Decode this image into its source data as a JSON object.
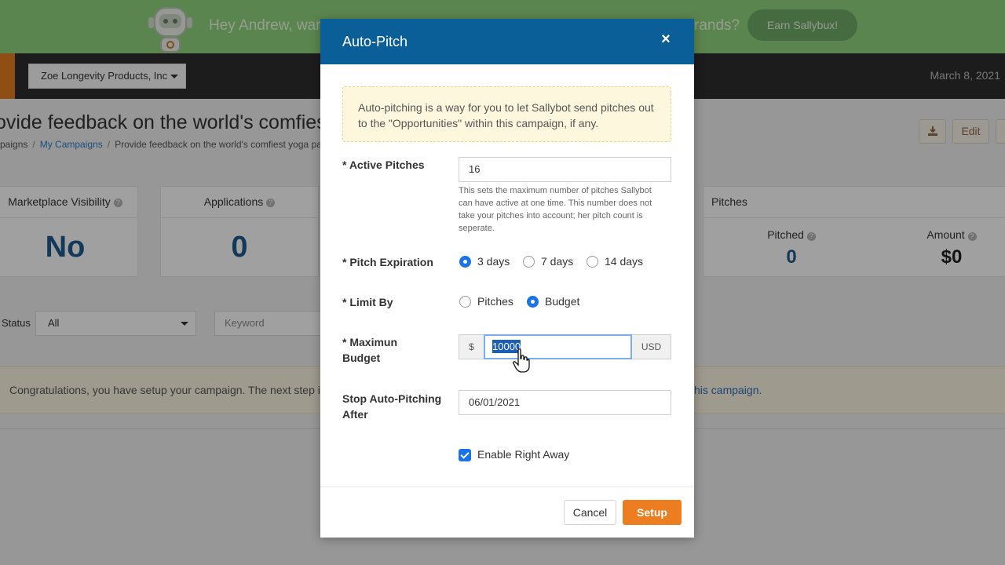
{
  "promo": {
    "text_left": "Hey Andrew, wan",
    "text_right": "rands?",
    "earn_button": "Earn Sallybux!"
  },
  "topbar": {
    "company": "Zoe Longevity Products, Inc",
    "date": "March 8, 2021"
  },
  "page": {
    "title": "ovide feedback on the world's comfiest y",
    "breadcrumb": [
      "paigns",
      "My Campaigns",
      "Provide feedback on the world's comfiest yoga pa"
    ],
    "buttons": {
      "edit": "Edit"
    }
  },
  "stats": [
    {
      "title": "Marketplace Visibility",
      "value": "No"
    },
    {
      "title": "Applications",
      "value": "0"
    }
  ],
  "pitches": {
    "title": "Pitches",
    "pitched_label": "Pitched",
    "pitched_value": "0",
    "amount_label": "Amount",
    "amount_value": "$0"
  },
  "filters": {
    "status_label": "Status",
    "status_value": "All",
    "keyword_placeholder": "Keyword"
  },
  "notice": {
    "text": "Congratulations, you have setup your campaign. The next step is",
    "link_tail": "his campaign."
  },
  "modal": {
    "title": "Auto-Pitch",
    "close": "×",
    "info": "Auto-pitching is a way for you to let Sallybot send pitches out to the \"Opportunities\" within this campaign, if any.",
    "active_pitches": {
      "label": "* Active Pitches",
      "value": "16",
      "help": "This sets the maximum number of pitches Sallybot can have active at one time. This number does not take your pitches into account; her pitch count is seperate."
    },
    "pitch_expiration": {
      "label": "* Pitch Expiration",
      "options": [
        "3 days",
        "7 days",
        "14 days"
      ],
      "selected": "3 days"
    },
    "limit_by": {
      "label": "* Limit By",
      "options": [
        "Pitches",
        "Budget"
      ],
      "selected": "Budget"
    },
    "max_budget": {
      "label_line1": "* Maximun",
      "label_line2": "Budget",
      "prefix": "$",
      "value": "10000",
      "suffix": "USD"
    },
    "stop_after": {
      "label_line1": "Stop Auto-Pitching",
      "label_line2": "After",
      "value": "06/01/2021"
    },
    "enable": {
      "label": "Enable Right Away",
      "checked": true
    },
    "buttons": {
      "cancel": "Cancel",
      "setup": "Setup"
    }
  },
  "colors": {
    "header_blue": "#0b5f99",
    "accent_orange": "#ec7d21",
    "radio_blue": "#1a73e8",
    "promo_green": "#8fd07b"
  }
}
